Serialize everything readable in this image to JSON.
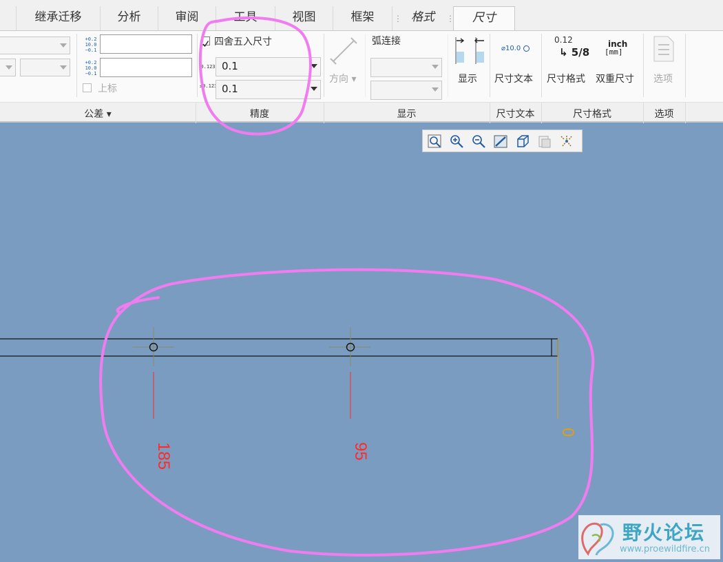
{
  "tabs": [
    {
      "label": "继承迁移",
      "italic": false
    },
    {
      "label": "分析",
      "italic": false
    },
    {
      "label": "审阅",
      "italic": false
    },
    {
      "label": "工具",
      "italic": false
    },
    {
      "label": "视图",
      "italic": false
    },
    {
      "label": "框架",
      "italic": false
    },
    {
      "label": "格式",
      "italic": true
    },
    {
      "label": "尺寸",
      "italic": true
    }
  ],
  "active_tab": "尺寸",
  "ribbon": {
    "tolerance": {
      "group_label": "公差 ▾",
      "upper_value": "",
      "lower_value": "",
      "upper_checkbox_label": "上标",
      "icon_upper": "+0.2 10.0 -0.1",
      "icon_lower": "+0.2 10.0 -0.1"
    },
    "precision": {
      "group_label": "精度",
      "round_checkbox_label": "四舍五入尺寸",
      "round_checked": true,
      "decimal_value": "0.1",
      "tolerance_decimal_value": "0.1",
      "decimal_icon": "0.123",
      "tolerance_decimal_icon": "±0.123"
    },
    "display": {
      "group_label": "显示",
      "direction_label": "方向 ▾",
      "arc_label": "弧连接",
      "show_label": "显示"
    },
    "dim_text": {
      "group_label": "尺寸文本",
      "button_label": "尺寸文本",
      "icon_text": "⌀10.0"
    },
    "dim_format": {
      "group_label": "尺寸格式",
      "format_label": "尺寸格式",
      "dual_label": "双重尺寸",
      "format_icon_top": "0.12",
      "format_icon_bottom": "5/8",
      "dual_icon_top": "inch",
      "dual_icon_bottom": "[mm]"
    },
    "options": {
      "group_label": "选项",
      "button_label": "选项"
    }
  },
  "view_toolbar": [
    "zoom-fit-icon",
    "zoom-in-icon",
    "zoom-out-icon",
    "repaint-icon",
    "view-orientation-icon",
    "layer-icon",
    "display-style-icon"
  ],
  "drawing": {
    "dimensions": [
      {
        "value": "185",
        "color": "#ff2a2a"
      },
      {
        "value": "95",
        "color": "#ff2a2a"
      },
      {
        "value": "0",
        "color": "#e0a010"
      }
    ]
  },
  "watermark": {
    "name": "野火论坛",
    "url": "www.proewildfire.cn"
  },
  "colors": {
    "canvas_bg": "#7a9cc0",
    "annotation": "#f07cf0",
    "dimension_red": "#ff2a2a",
    "dimension_orange": "#e0a010"
  }
}
